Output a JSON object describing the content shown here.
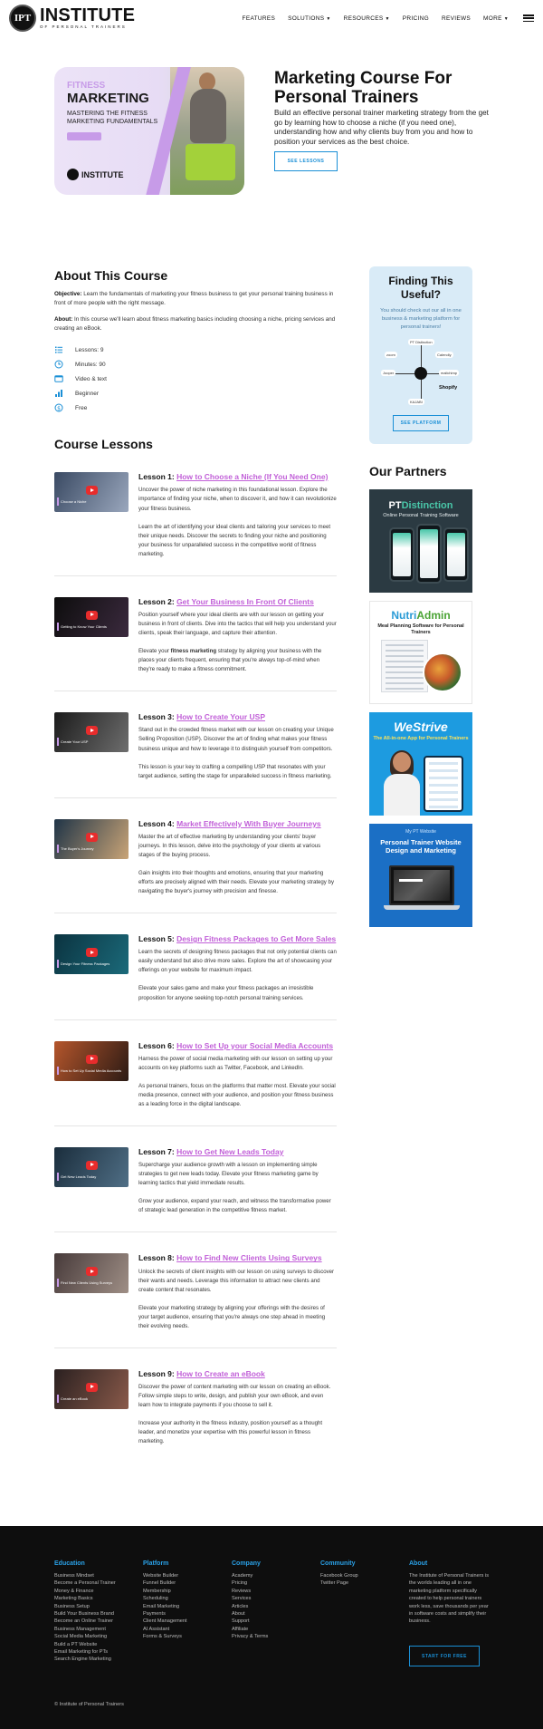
{
  "header": {
    "logo_emblem": "IPT",
    "logo_main": "INSTITUTE",
    "logo_sub": "OF PERSONAL TRAINERS",
    "nav": [
      {
        "label": "FEATURES",
        "has_caret": false
      },
      {
        "label": "SOLUTIONS",
        "has_caret": true
      },
      {
        "label": "RESOURCES",
        "has_caret": true
      },
      {
        "label": "PRICING",
        "has_caret": false
      },
      {
        "label": "REVIEWS",
        "has_caret": false
      },
      {
        "label": "MORE",
        "has_caret": true
      }
    ],
    "caret": "▼",
    "menu_icon": "hamburger-icon"
  },
  "hero": {
    "image": {
      "fitness": "FITNESS",
      "marketing": "MARKETING",
      "subtitle": "MASTERING THE FITNESS MARKETING FUNDAMENTALS",
      "logo": "INSTITUTE"
    },
    "title": "Marketing Course For Personal Trainers",
    "description": "Build an effective personal trainer marketing strategy from the get go by learning how to choose a niche (if you need one), understanding how and why clients buy from you and how to position your services as the best choice.",
    "button": "SEE LESSONS"
  },
  "about": {
    "title": "About This Course",
    "objective_label": "Objective:",
    "objective_text": " Learn the fundamentals of marketing your fitness business to get your personal training business in front of more people with the right message.",
    "about_label": "About:",
    "about_text": " In this course we'll learn about fitness marketing basics including choosing a niche, pricing services and creating an eBook.",
    "meta": [
      {
        "icon": "list-icon",
        "text": "Lessons: 9"
      },
      {
        "icon": "clock-icon",
        "text": "Minutes: 90"
      },
      {
        "icon": "video-icon",
        "text": "Video & text"
      },
      {
        "icon": "level-bars-icon",
        "text": "Beginner"
      },
      {
        "icon": "dollar-icon",
        "text": "Free"
      }
    ]
  },
  "lessons_title": "Course Lessons",
  "lessons": [
    {
      "prefix": "Lesson 1:",
      "title": "How to Choose a Niche (If You Need One)",
      "thumb_caption": "Choose a Niche",
      "thumb_colors": [
        "#3a4a63",
        "#9aa7bd"
      ],
      "p1": "Uncover the power of niche marketing in this foundational lesson. Explore the importance of finding your niche, when to discover it, and how it can revolutionize your fitness business.",
      "p2": "Learn the art of identifying your ideal clients and tailoring your services to meet their unique needs. Discover the secrets to finding your niche and positioning your business for unparalleled success in the competitive world of fitness marketing."
    },
    {
      "prefix": "Lesson 2:",
      "title": "Get Your Business In Front Of Clients",
      "thumb_caption": "Getting to Know Your Clients",
      "thumb_colors": [
        "#0d0d0d",
        "#3b2a3e"
      ],
      "p1": "Position yourself where your ideal clients are with our lesson on getting your business in front of clients. Dive into the tactics that will help you understand your clients, speak their language, and capture their attention.",
      "p2_before": "Elevate your ",
      "p2_bold": "fitness marketing",
      "p2_after": " strategy by aligning your business with the places your clients frequent, ensuring that you're always top-of-mind when they're ready to make a fitness commitment."
    },
    {
      "prefix": "Lesson 3:",
      "title": "How to Create Your USP",
      "thumb_caption": "Create Your USP",
      "thumb_colors": [
        "#1b1b1b",
        "#6e6e6e"
      ],
      "p1": "Stand out in the crowded fitness market with our lesson on creating your Unique Selling Proposition (USP). Discover the art of finding what makes your fitness business unique and how to leverage it to distinguish yourself from competitors.",
      "p2": "This lesson is your key to crafting a compelling USP that resonates with your target audience, setting the stage for unparalleled success in fitness marketing."
    },
    {
      "prefix": "Lesson 4:",
      "title": "Market Effectively With Buyer Journeys",
      "thumb_caption": "The Buyer's Journey",
      "thumb_colors": [
        "#1f3447",
        "#c9a477"
      ],
      "p1": "Master the art of effective marketing by understanding your clients' buyer journeys. In this lesson, delve into the psychology of your clients at various stages of the buying process.",
      "p2": "Gain insights into their thoughts and emotions, ensuring that your marketing efforts are precisely aligned with their needs. Elevate your marketing strategy by navigating the buyer's journey with precision and finesse."
    },
    {
      "prefix": "Lesson 5:",
      "title": "Design Fitness Packages to Get More Sales",
      "thumb_caption": "Design Your Fitness Packages",
      "thumb_colors": [
        "#0b3340",
        "#1b6a7a"
      ],
      "p1": "Learn the secrets of designing fitness packages that not only potential clients can easily understand but also drive more sales. Explore the art of showcasing your offerings on your website for maximum impact.",
      "p2": "Elevate your sales game and make your fitness packages an irresistible proposition for anyone seeking top-notch personal training services."
    },
    {
      "prefix": "Lesson 6:",
      "title": "How to Set Up your Social Media Accounts",
      "thumb_caption": "How to Set Up Social Media Accounts",
      "thumb_colors": [
        "#b5562c",
        "#2b1a14"
      ],
      "p1": "Harness the power of social media marketing with our lesson on setting up your accounts on key platforms such as Twitter, Facebook, and LinkedIn.",
      "p2": "As personal trainers, focus on the platforms that matter most. Elevate your social media presence, connect with your audience, and position your fitness business as a leading force in the digital landscape."
    },
    {
      "prefix": "Lesson 7:",
      "title": "How to Get New Leads Today",
      "thumb_caption": "Get New Leads Today",
      "thumb_colors": [
        "#1a2d3c",
        "#506f86"
      ],
      "p1": "Supercharge your audience growth with a lesson on implementing simple strategies to get new leads today. Elevate your fitness marketing game by learning tactics that yield immediate results.",
      "p2": "Grow your audience, expand your reach, and witness the transformative power of strategic lead generation in the competitive fitness market."
    },
    {
      "prefix": "Lesson 8:",
      "title": "How to Find New Clients Using Surveys",
      "thumb_caption": "Find New Clients Using Surveys",
      "thumb_colors": [
        "#473a3a",
        "#9f8f86"
      ],
      "p1": "Unlock the secrets of client insights with our lesson on using surveys to discover their wants and needs. Leverage this information to attract new clients and create content that resonates.",
      "p2": "Elevate your marketing strategy by aligning your offerings with the desires of your target audience, ensuring that you're always one step ahead in meeting their evolving needs."
    },
    {
      "prefix": "Lesson 9:",
      "title": "How to Create an eBook",
      "thumb_caption": "Create an eBook",
      "thumb_colors": [
        "#2a2020",
        "#8a5a4a"
      ],
      "p1": "Discover the power of content marketing with our lesson on creating an eBook. Follow simple steps to write, design, and publish your own eBook, and even learn how to integrate payments if you choose to sell it.",
      "p2": "Increase your authority in the fitness industry, position yourself as a thought leader, and monetize your expertise with this powerful lesson in fitness marketing."
    }
  ],
  "sidebar": {
    "useful_title": "Finding This Useful?",
    "useful_text": "You should check out our all in one business & marketing platform for personal trainers!",
    "diagram_nodes": [
      "PT Distinction",
      "Calendly",
      "Jooper",
      "mailchimp",
      "Shopify",
      "KAJABI",
      "zoom"
    ],
    "diagram_hub": "IPT",
    "useful_button": "SEE PLATFORM",
    "partners_title": "Our Partners",
    "partners": [
      {
        "brand_a": "PT",
        "brand_b": "Distinction",
        "subtitle": "Online Personal Training Software"
      },
      {
        "brand_a": "Nutri",
        "brand_b": "Admin",
        "subtitle": "Meal Planning Software for Personal Trainers"
      },
      {
        "brand": "WeStrive",
        "subtitle": "The All-in-one App for Personal Trainers"
      },
      {
        "brand": "My PT Website",
        "subtitle": "Personal Trainer Website Design and Marketing"
      }
    ]
  },
  "footer": {
    "columns": [
      {
        "heading": "Education",
        "links": [
          "Business Mindset",
          "Become a Personal Trainer",
          "Money & Finance",
          "Marketing Basics",
          "Business Setup",
          "Build Your Business Brand",
          "Become an Online Trainer",
          "Business Management",
          "Social Media Marketing",
          "Build a PT Website",
          "Email Marketing for PTs",
          "Search Engine Marketing"
        ]
      },
      {
        "heading": "Platform",
        "links": [
          "Website Builder",
          "Funnel Builder",
          "Membership",
          "Scheduling",
          "Email Marketing",
          "Payments",
          "Client Management",
          "AI Assistant",
          "Forms & Surveys"
        ]
      },
      {
        "heading": "Company",
        "links": [
          "Academy",
          "Pricing",
          "Reviews",
          "Services",
          "Articles",
          "About",
          "Support",
          "Affiliate",
          "Privacy & Terms"
        ]
      },
      {
        "heading": "Community",
        "links": [
          "Facebook Group",
          "Twitter Page"
        ]
      }
    ],
    "about_heading": "About",
    "about_text": "The Institute of Personal Trainers is the worlds leading all in one marketing platform specifically created to help personal trainers work less, save thousands per year in software costs and simplify their business.",
    "button": "START FOR FREE",
    "copyright": "© Institute of Personal Trainers"
  },
  "colors": {
    "accent_blue": "#1a8fd6",
    "lesson_link": "#c15fd8",
    "card_bg": "#d9ebf7",
    "footer_bg": "#0e0e0e",
    "footer_heading": "#2aa0e6"
  }
}
